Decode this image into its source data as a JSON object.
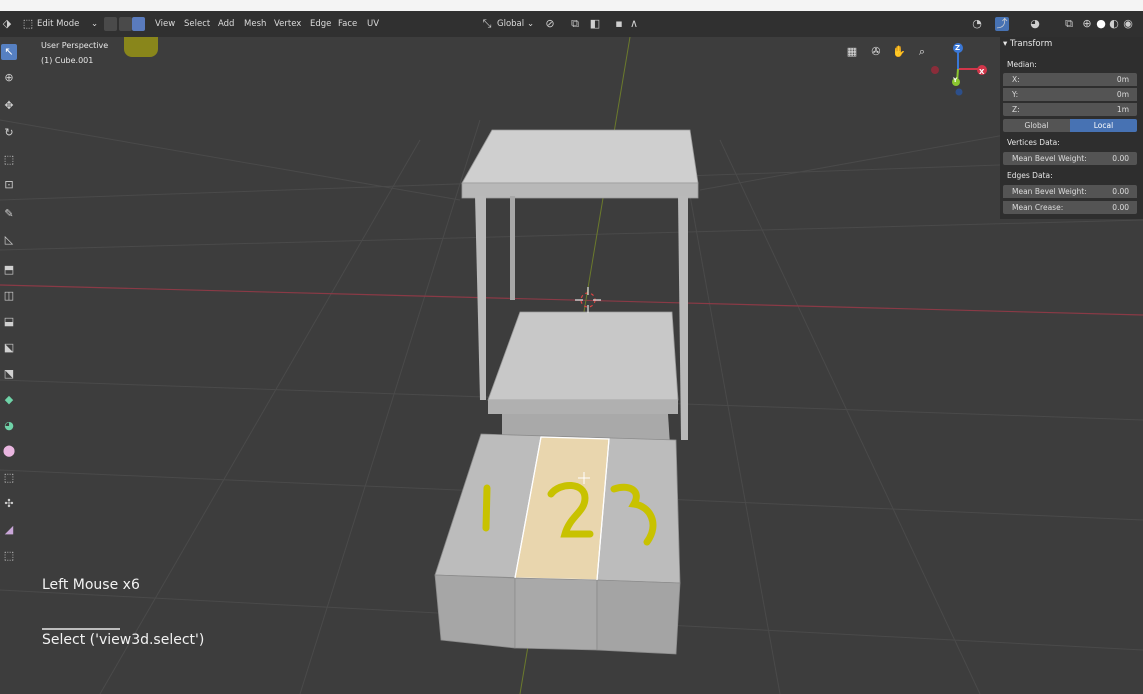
{
  "header": {
    "mode_label": "Edit Mode",
    "menus": [
      "View",
      "Select",
      "Add",
      "Mesh",
      "Vertex",
      "Edge",
      "Face",
      "UV"
    ],
    "orientation_label": "Global"
  },
  "viewport": {
    "view_name": "User Perspective",
    "object_name": "(1) Cube.001"
  },
  "gizmo": {
    "x_label": "X",
    "y_label": "Y",
    "z_label": "Z",
    "x_color": "#d2364a",
    "y_color": "#8bc62f",
    "z_color": "#3a77d6"
  },
  "transform_panel": {
    "title": "Transform",
    "median_label": "Median:",
    "fields": [
      {
        "label": "X:",
        "value": "0m"
      },
      {
        "label": "Y:",
        "value": "0m"
      },
      {
        "label": "Z:",
        "value": "1m"
      }
    ],
    "space_options": [
      "Global",
      "Local"
    ],
    "space_selected": "Local",
    "vertices_data_label": "Vertices Data:",
    "vertex_bevel": {
      "label": "Mean Bevel Weight:",
      "value": "0.00"
    },
    "edges_data_label": "Edges Data:",
    "edge_bevel": {
      "label": "Mean Bevel Weight:",
      "value": "0.00"
    },
    "edge_crease": {
      "label": "Mean Crease:",
      "value": "0.00"
    }
  },
  "status": {
    "input_event": "Left Mouse x6",
    "operator": "Select ('view3d.select')"
  },
  "colors": {
    "header_bg": "#303030",
    "viewport_bg": "#3d3d3d",
    "accent": "#4772b3",
    "selected_face": "#e9d6ae",
    "annotation": "#c8c200"
  }
}
